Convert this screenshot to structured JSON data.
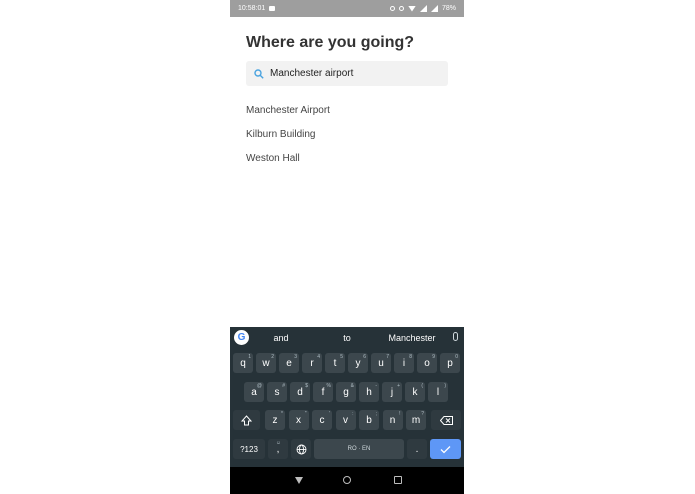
{
  "status_bar": {
    "time": "10:58:01",
    "battery": "78%"
  },
  "page": {
    "title": "Where are you going?"
  },
  "search": {
    "value": "Manchester airport"
  },
  "results": [
    "Manchester Airport",
    "Kilburn Building",
    "Weston Hall"
  ],
  "keyboard": {
    "suggestions": [
      "and",
      "to",
      "Manchester"
    ],
    "row1": [
      [
        "q",
        "1"
      ],
      [
        "w",
        "2"
      ],
      [
        "e",
        "3"
      ],
      [
        "r",
        "4"
      ],
      [
        "t",
        "5"
      ],
      [
        "y",
        "6"
      ],
      [
        "u",
        "7"
      ],
      [
        "i",
        "8"
      ],
      [
        "o",
        "9"
      ],
      [
        "p",
        "0"
      ]
    ],
    "row2": [
      [
        "a",
        "@"
      ],
      [
        "s",
        "#"
      ],
      [
        "d",
        "$"
      ],
      [
        "f",
        "%"
      ],
      [
        "g",
        "&"
      ],
      [
        "h",
        "-"
      ],
      [
        "j",
        "+"
      ],
      [
        "k",
        "("
      ],
      [
        "l",
        ")"
      ]
    ],
    "row3": [
      [
        "z",
        "*"
      ],
      [
        "x",
        "\""
      ],
      [
        "c",
        "'"
      ],
      [
        "v",
        ":"
      ],
      [
        "b",
        ";"
      ],
      [
        "n",
        "!"
      ],
      [
        "m",
        "?"
      ]
    ],
    "symbols_label": "?123",
    "comma_label": ",",
    "space_label": "RO · EN",
    "period_label": "."
  },
  "colors": {
    "keyboard_bg": "#263238",
    "key_bg": "#3c474d",
    "enter_bg": "#5e97f6"
  }
}
